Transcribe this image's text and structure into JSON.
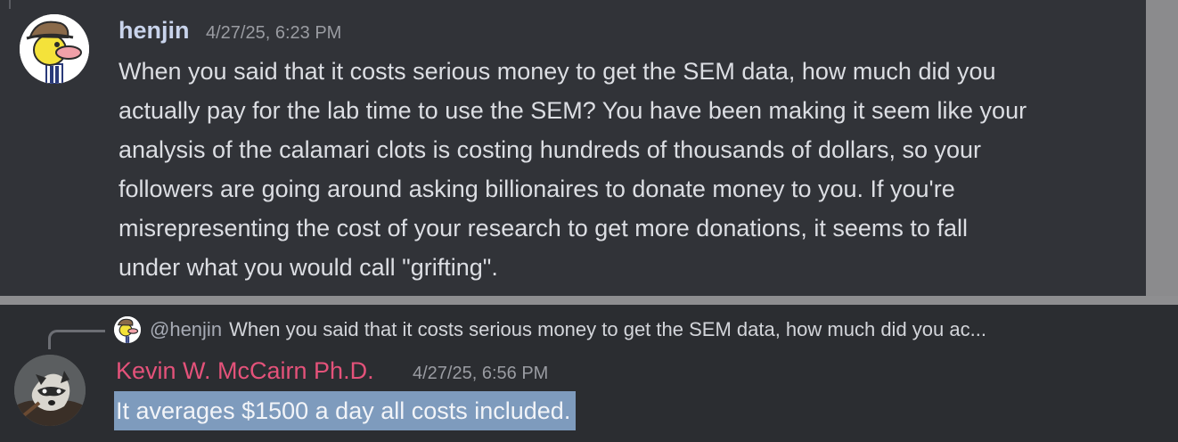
{
  "messages": [
    {
      "author": "henjin",
      "timestamp": "4/27/25, 6:23 PM",
      "avatar_icon": "cartoon-duck-avatar-icon",
      "lines": [
        "When you said that it costs serious money to get the SEM data, how much did you",
        "actually pay for the lab time to use the SEM? You have been making it seem like your",
        "analysis of the calamari clots is costing hundreds of thousands of dollars, so your",
        "followers are going around asking billionaires to donate money to you. If you're",
        "misrepresenting the cost of your research to get more donations, it seems to fall",
        "under what you would call \"grifting\"."
      ]
    },
    {
      "author": "Kevin W. McCairn Ph.D.",
      "timestamp": "4/27/25, 6:56 PM",
      "avatar_icon": "raccoon-avatar-icon",
      "reply_to": {
        "mention": "@henjin",
        "snippet": "When you said that it costs serious money to get the SEM data, how much did you ac..."
      },
      "text": "It averages $1500 a day all costs included."
    }
  ],
  "colors": {
    "message_bg": "#313338",
    "chat_bg": "#2b2d31",
    "henjin_name": "#c9d4ec",
    "kevin_name": "#e4527a",
    "selection_highlight": "#7e9bbd",
    "body_text": "#dcdee3"
  }
}
